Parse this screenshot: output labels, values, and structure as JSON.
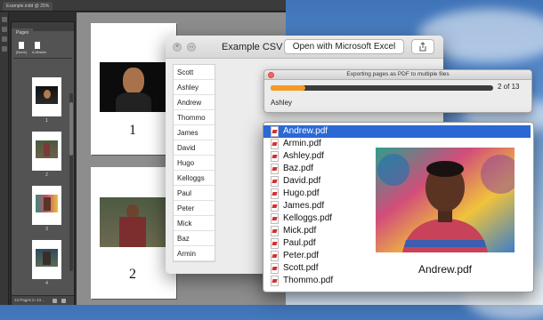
{
  "indesign": {
    "doc_tab": "Example.indd @ 25%",
    "panel_tab": "Pages",
    "masters": [
      "[None]",
      "A-Master"
    ],
    "thumb_numbers": [
      "1",
      "2",
      "3",
      "4"
    ],
    "footer_text": "13 Pages in 13…",
    "page_numbers": [
      "1",
      "2"
    ]
  },
  "csv": {
    "title": "Example CSV",
    "open_button": "Open with Microsoft Excel",
    "names": [
      "Scott",
      "Ashley",
      "Andrew",
      "Thommo",
      "James",
      "David",
      "Hugo",
      "Kelloggs",
      "Paul",
      "Peter",
      "Mick",
      "Baz",
      "Armin"
    ]
  },
  "export": {
    "title": "Exporting pages as PDF to multiple files",
    "progress_fraction": 0.154,
    "count": "2 of 13",
    "current_name": "Ashley"
  },
  "finder": {
    "files": [
      "Andrew.pdf",
      "Armin.pdf",
      "Ashley.pdf",
      "Baz.pdf",
      "David.pdf",
      "Hugo.pdf",
      "James.pdf",
      "Kelloggs.pdf",
      "Mick.pdf",
      "Paul.pdf",
      "Peter.pdf",
      "Scott.pdf",
      "Thommo.pdf"
    ],
    "selected": "Andrew.pdf",
    "preview_name": "Andrew.pdf"
  },
  "colors": {
    "progress_fill": "#f59b22",
    "selection": "#2b68d6",
    "pdf_red": "#d52f2f"
  },
  "icons": [
    "close-icon",
    "minimize-icon",
    "share-icon",
    "pdf-file-icon"
  ]
}
